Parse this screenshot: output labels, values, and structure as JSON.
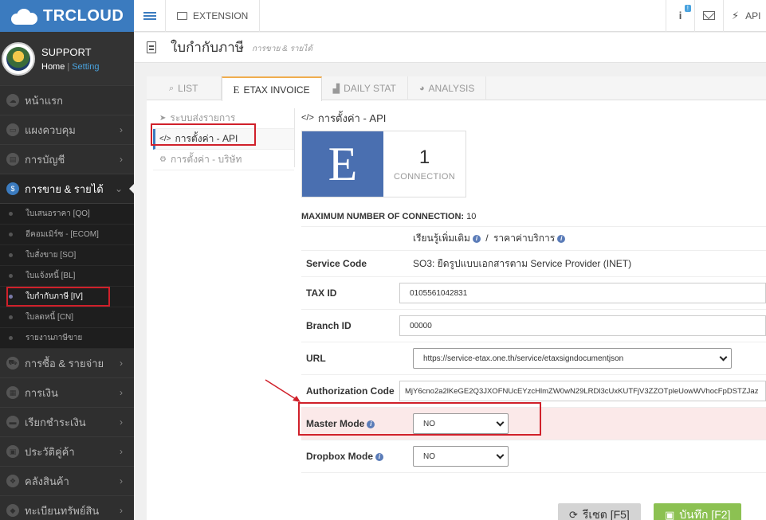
{
  "brand": {
    "name": "TRCLOUD"
  },
  "user": {
    "name": "SUPPORT",
    "home_link": "Home",
    "separator": "|",
    "setting_link": "Setting"
  },
  "sidebar": {
    "items": [
      {
        "label": "หน้าแรก",
        "icon": "cloud-icon"
      },
      {
        "label": "แผงควบคุม",
        "icon": "monitor-icon"
      },
      {
        "label": "การบัญชี",
        "icon": "book-icon"
      },
      {
        "label": "การขาย & รายได้",
        "icon": "dollar-icon"
      }
    ],
    "sub_items": [
      {
        "label": "ใบเสนอราคา [QO]"
      },
      {
        "label": "อีคอมเมิร์ซ - [ECOM]"
      },
      {
        "label": "ใบสั่งขาย [SO]"
      },
      {
        "label": "ใบแจ้งหนี้ [BL]"
      },
      {
        "label": "ใบกำกับภาษี [IV]"
      },
      {
        "label": "ใบลดหนี้ [CN]"
      },
      {
        "label": "รายงานภาษีขาย"
      }
    ],
    "bottom_items": [
      {
        "label": "การซื้อ & รายจ่าย"
      },
      {
        "label": "การเงิน"
      },
      {
        "label": "เรียกชำระเงิน"
      },
      {
        "label": "ประวัติคู่ค้า"
      },
      {
        "label": "คลังสินค้า"
      },
      {
        "label": "ทะเบียนทรัพย์สิน"
      }
    ]
  },
  "topbar": {
    "extension_label": "EXTENSION",
    "info_badge": "!",
    "api_label": "API"
  },
  "page": {
    "title": "ใบกำกับภาษี",
    "subtitle": "การขาย & รายได้"
  },
  "tabs": [
    {
      "label": "LIST",
      "icon": "search-icon"
    },
    {
      "label": "ETAX INVOICE",
      "icon": "E",
      "active": true
    },
    {
      "label": "DAILY STAT",
      "icon": "chart-icon"
    },
    {
      "label": "ANALYSIS",
      "icon": "pie-icon"
    }
  ],
  "subnav": [
    {
      "label": "ระบบส่งรายการ",
      "icon": "send-icon"
    },
    {
      "label": "การตั้งค่า - API",
      "icon": "code-icon",
      "active": true
    },
    {
      "label": "การตั้งค่า - บริษัท",
      "icon": "gear-icon"
    }
  ],
  "api": {
    "section_title": "การตั้งค่า - API",
    "section_icon": "</>",
    "logo_letter": "E",
    "connection_count": "1",
    "connection_label": "CONNECTION",
    "max_label": "MAXIMUM NUMBER OF CONNECTION:",
    "max_value": "10",
    "learn_more": "เรียนรู้เพิ่มเติม",
    "learn_sep": "/",
    "pricing": "ราคาค่าบริการ"
  },
  "form": {
    "service_code_label": "Service Code",
    "service_code_value": "SO3: ยืดรูปแบบเอกสารตาม Service Provider (INET)",
    "tax_id_label": "TAX ID",
    "tax_id_value": "0105561042831",
    "branch_label": "Branch ID",
    "branch_value": "00000",
    "url_label": "URL",
    "url_value": "https://service-etax.one.th/service/etaxsigndocumentjson",
    "auth_label": "Authorization Code",
    "auth_value": "MjY6cno2a2lKeGE2Q3JXOFNUcEYzcHlmZW0wN29LRDl3cUxKUTFjV3ZZOTpleUowWVhocFpDSTZJaz",
    "master_label": "Master Mode",
    "master_value": "NO",
    "dropbox_label": "Dropbox Mode",
    "dropbox_value": "NO"
  },
  "buttons": {
    "reset": "รีเซต [F5]",
    "save": "บันทึก [F2]"
  },
  "colors": {
    "brand": "#3b7bbf",
    "sidebar": "#2f2f2f",
    "etax_logo": "#4a6fb0",
    "highlight": "#d0202a",
    "save": "#8cc152",
    "tab_active": "#f0ad4e"
  }
}
